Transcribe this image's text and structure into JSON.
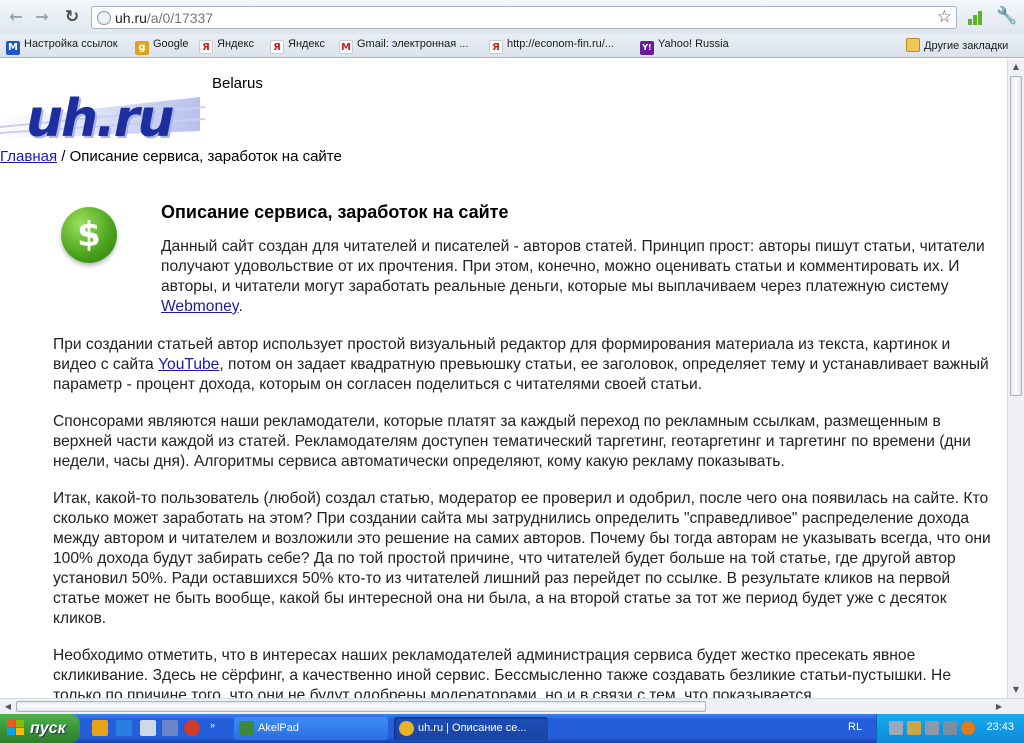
{
  "browser": {
    "url_host": "uh.ru",
    "url_path": "/a/0/17337",
    "bookmarks": [
      {
        "label": "Настройка ссылок",
        "icon": "M",
        "color": "#1a58c9"
      },
      {
        "label": "Google",
        "icon": "g",
        "color": "#e0a516"
      },
      {
        "label": "Яндекс",
        "icon": "Я",
        "color": "#d22020"
      },
      {
        "label": "Яндекс",
        "icon": "Я",
        "color": "#d22020"
      },
      {
        "label": "Gmail: электронная ...",
        "icon": "M",
        "color": "#c5221f"
      },
      {
        "label": "http://econom-fin.ru/...",
        "icon": "Я",
        "color": "#d22020"
      },
      {
        "label": "Yahoo! Russia",
        "icon": "Y!",
        "color": "#6b1a9b"
      }
    ],
    "other_bookmarks": "Другие закладки"
  },
  "page": {
    "logo": "uh.ru",
    "region": "Belarus",
    "breadcrumb_home": "Главная",
    "breadcrumb_sep": " / ",
    "breadcrumb_current": "Описание сервиса, заработок на сайте",
    "title": "Описание сервиса, заработок на сайте",
    "intro_text": "Данный сайт создан для читателей и писателей - авторов статей. Принцип прост: авторы пишут статьи, читатели получают удовольствие от их прочтения. При этом, конечно, можно оценивать статьи и комментировать их. И авторы, и читатели могут заработать реальные деньги, которые мы выплачиваем через платежную систему ",
    "intro_link": "Webmoney",
    "intro_end": ".",
    "p1_text": "При создании статьей автор использует простой визуальный редактор для формирования материала из текста, картинок и видео с сайта ",
    "p1_link": "YouTube",
    "p1_end": ", потом он задает квадратную превьюшку статьи, ее заголовок, определяет тему и устанавливает важный параметр - процент дохода, которым он согласен поделиться с читателями своей статьи.",
    "p2": "Спонсорами являются наши рекламодатели, которые платят за каждый переход по рекламным ссылкам, размещенным в верхней части каждой из статей. Рекламодателям доступен тематический таргетинг, геотаргетинг и таргетинг по времени (дни недели, часы дня). Алгоритмы сервиса автоматически определяют, кому какую рекламу показывать.",
    "p3": "Итак, какой-то пользователь (любой) создал статью, модератор ее проверил и одобрил, после чего она появилась на сайте. Кто сколько может заработать на этом? При создании сайта мы затруднились определить \"справедливое\" распределение дохода между автором и читателем и возложили это решение на самих авторов. Почему бы тогда авторам не указывать всегда, что они 100% дохода будут забирать себе? Да по той простой причине, что читателей будет больше на той статье, где другой автор установил 50%. Ради оставшихся 50% кто-то из читателей лишний раз перейдет по ссылке. В результате кликов на первой статье может не быть вообще, какой бы интересной она ни была, а на второй статье за тот же период будет уже с десяток кликов.",
    "p4": "Необходимо отметить, что в интересах наших рекламодателей администрация сервиса будет жестко пресекать явное скликивание. Здесь не сёрфинг, а качественно иной сервис. Бессмысленно также создавать безликие статьи-пустышки. Не только по причине того, что они не будут одобрены модераторами, но и в связи с тем, что показывается"
  },
  "taskbar": {
    "start_label": "пуск",
    "tasks": [
      {
        "label": "AkelPad",
        "color": "#3a8a3a"
      },
      {
        "label": "uh.ru | Описание се...",
        "color": "#e8b32a"
      }
    ],
    "lang": "RL",
    "clock": "23:43"
  }
}
